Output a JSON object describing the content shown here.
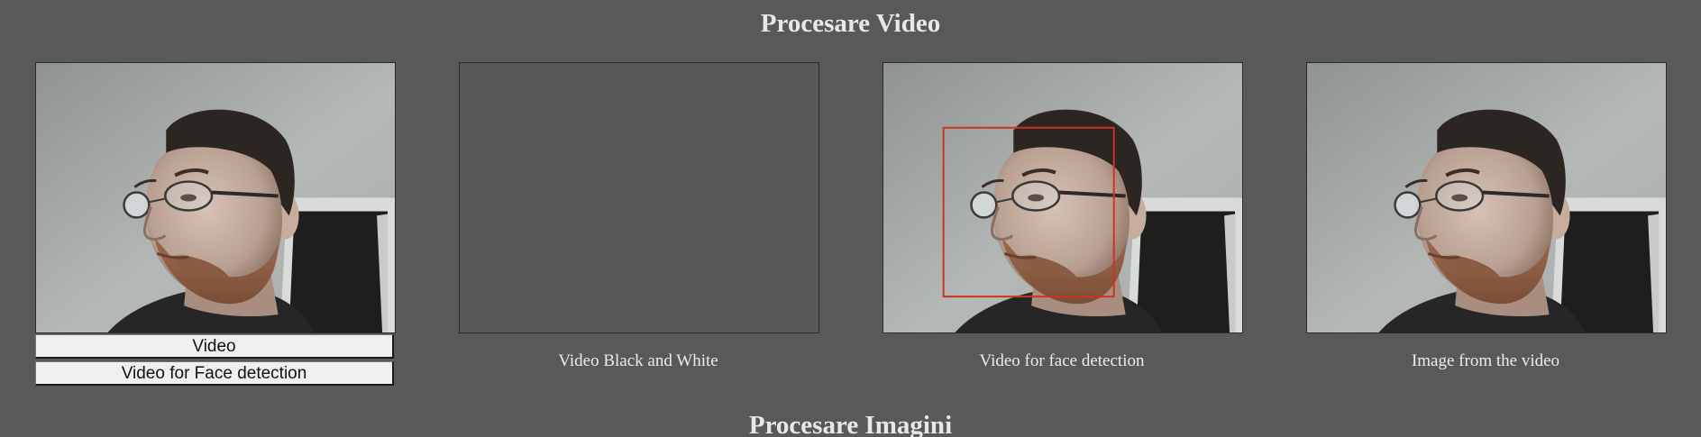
{
  "headings": {
    "video_section": "Procesare Video",
    "image_section": "Procesare Imagini"
  },
  "buttons": {
    "video": "Video",
    "face_detection": "Video for Face detection"
  },
  "captions": {
    "black_white": "Video Black and White",
    "face_detection": "Video for face detection",
    "image_from_video": "Image from the video"
  },
  "colors": {
    "background": "#595959",
    "detection_box": "#cc3322"
  }
}
